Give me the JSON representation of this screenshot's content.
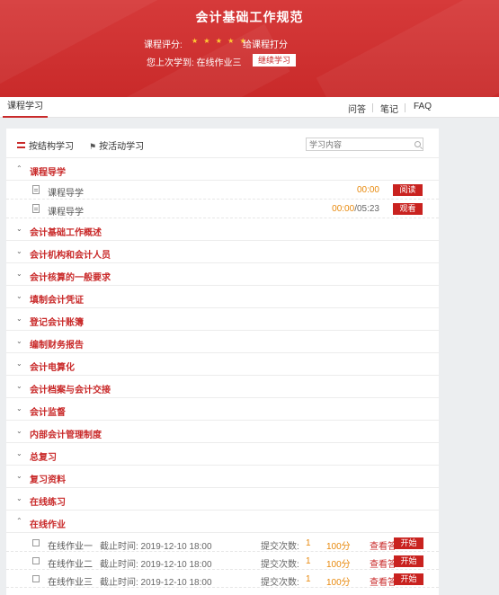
{
  "banner": {
    "title": "会计基础工作规范",
    "rating_label": "课程评分:",
    "stars": "★ ★ ★ ★ ★",
    "rate_link": "给课程打分",
    "last_studied": "您上次学到:  在线作业三",
    "continue_button": "继续学习"
  },
  "tabs": {
    "active": "课程学习",
    "links": [
      "问答",
      "笔记",
      "FAQ"
    ]
  },
  "panel": {
    "view_structure": "按结构学习",
    "view_activity": "按活动学习",
    "search_placeholder": "学习内容"
  },
  "chapters": [
    {
      "label": "课程导学",
      "expanded": true
    },
    {
      "label": "会计基础工作概述",
      "expanded": false
    },
    {
      "label": "会计机构和会计人员",
      "expanded": false
    },
    {
      "label": "会计核算的一般要求",
      "expanded": false
    },
    {
      "label": "填制会计凭证",
      "expanded": false
    },
    {
      "label": "登记会计账簿",
      "expanded": false
    },
    {
      "label": "编制财务报告",
      "expanded": false
    },
    {
      "label": "会计电算化",
      "expanded": false
    },
    {
      "label": "会计档案与会计交接",
      "expanded": false
    },
    {
      "label": "会计监督",
      "expanded": false
    },
    {
      "label": "内部会计管理制度",
      "expanded": false
    },
    {
      "label": "总复习",
      "expanded": false
    },
    {
      "label": "复习资料",
      "expanded": false
    },
    {
      "label": "在线练习",
      "expanded": false
    },
    {
      "label": "在线作业",
      "expanded": true
    }
  ],
  "intro_items": [
    {
      "name": "课程导学",
      "time": "00:00",
      "total": "",
      "action": "阅读"
    },
    {
      "name": "课程导学",
      "time": "00:00",
      "total": "/05:23",
      "action": "观看"
    }
  ],
  "homework": [
    {
      "name": "在线作业一",
      "deadline": "截止时间: 2019-12-10 18:00",
      "subs_label": "提交次数:",
      "count": "1",
      "score": "100分",
      "view": "查看答案",
      "start": "开始"
    },
    {
      "name": "在线作业二",
      "deadline": "截止时间: 2019-12-10 18:00",
      "subs_label": "提交次数:",
      "count": "1",
      "score": "100分",
      "view": "查看答案",
      "start": "开始"
    },
    {
      "name": "在线作业三",
      "deadline": "截止时间: 2019-12-10 18:00",
      "subs_label": "提交次数:",
      "count": "1",
      "score": "100分",
      "view": "查看答案",
      "start": "开始"
    }
  ],
  "colors": {
    "brand_red": "#c92a2a",
    "orange": "#e8890c",
    "star": "#ffcc33"
  }
}
